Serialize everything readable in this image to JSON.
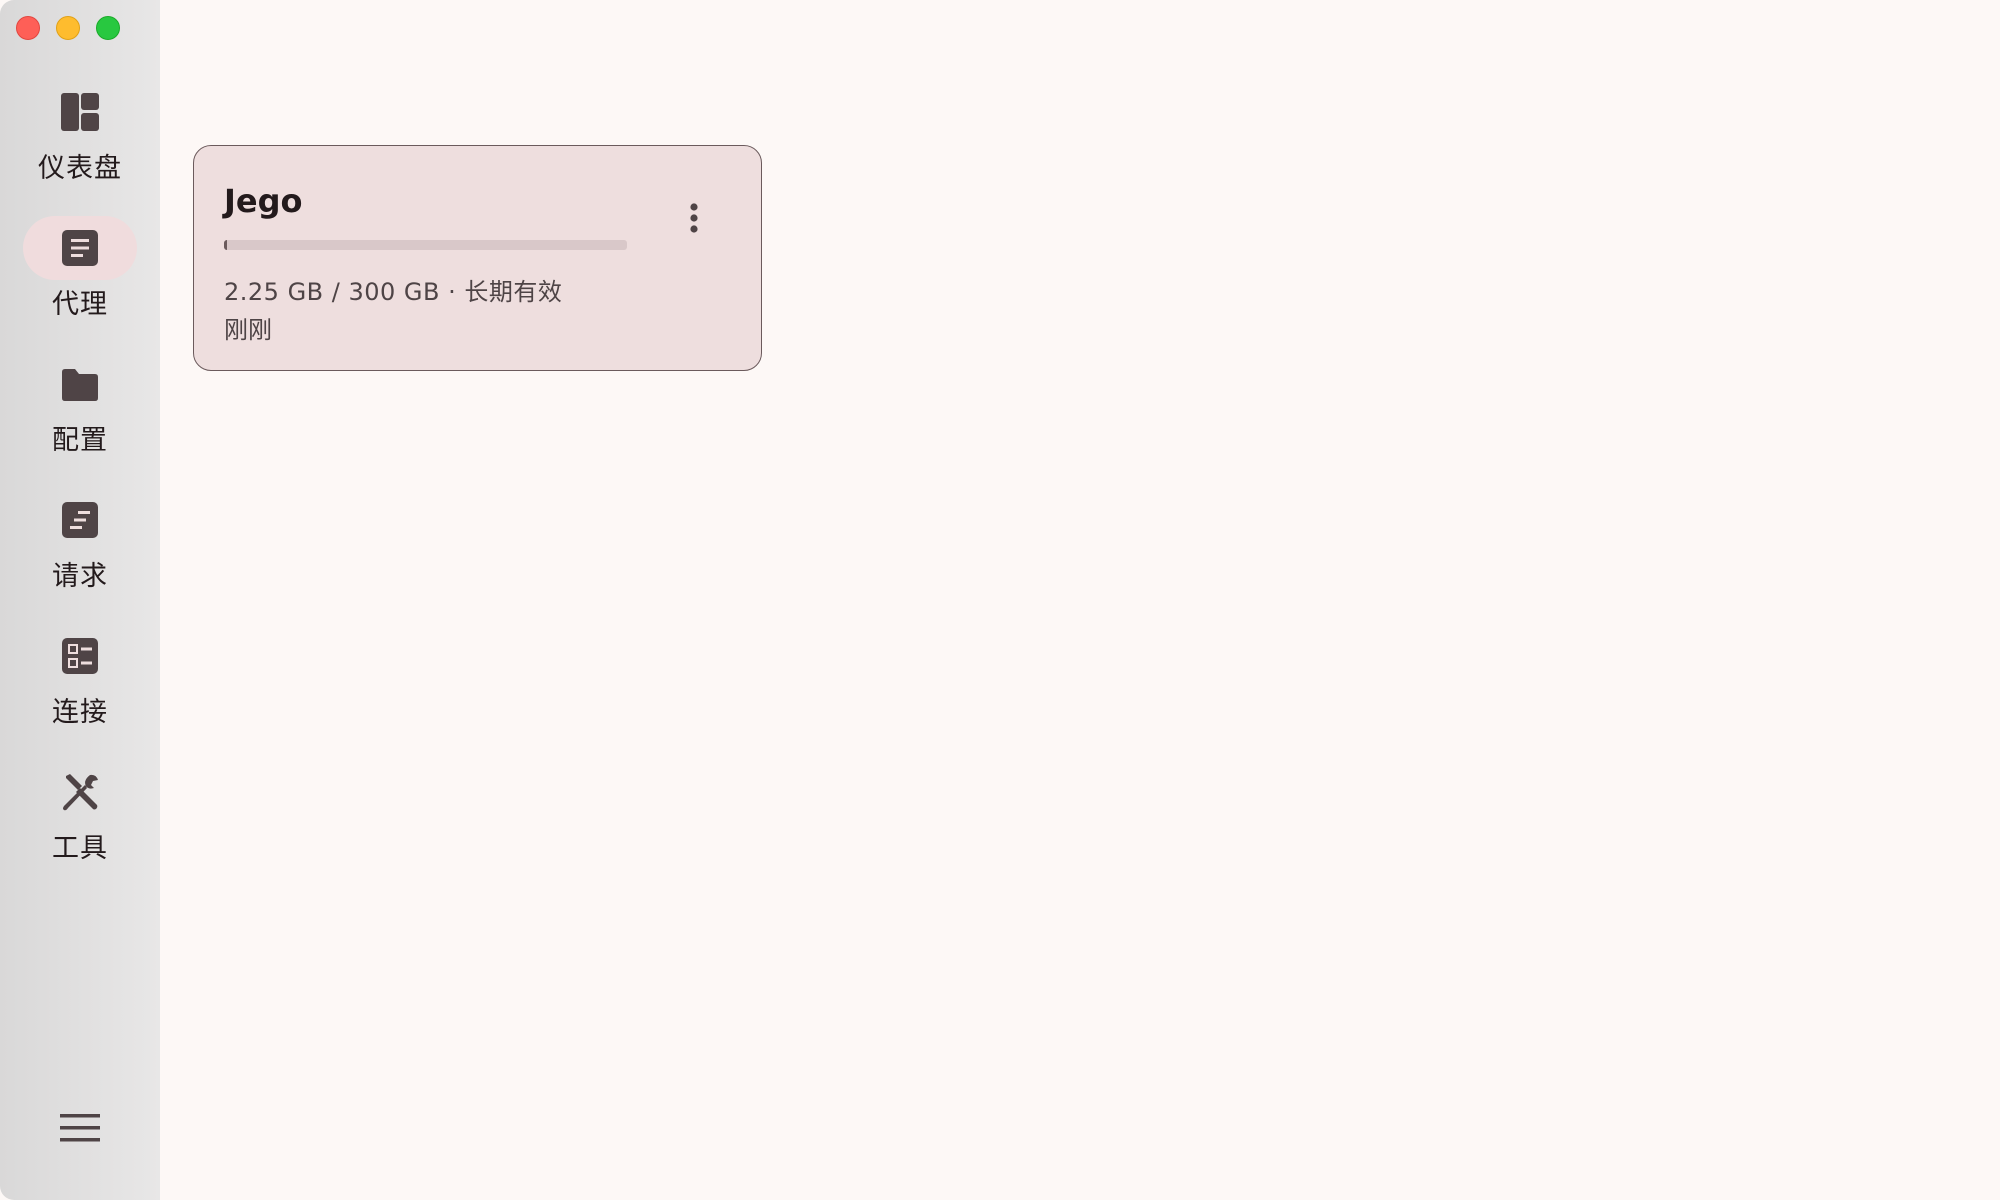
{
  "sidebar": {
    "items": [
      {
        "label": "仪表盘",
        "icon": "dashboard-icon",
        "active": false
      },
      {
        "label": "代理",
        "icon": "proxy-list-icon",
        "active": true
      },
      {
        "label": "配置",
        "icon": "folder-icon",
        "active": false
      },
      {
        "label": "请求",
        "icon": "requests-icon",
        "active": false
      },
      {
        "label": "连接",
        "icon": "connections-icon",
        "active": false
      },
      {
        "label": "工具",
        "icon": "tools-icon",
        "active": false
      }
    ],
    "menu_icon": "hamburger-menu-icon"
  },
  "profile_card": {
    "name": "Jego",
    "usage_text": "2.25 GB / 300 GB · 长期有效",
    "updated": "刚刚",
    "usage_fraction": 0.0075,
    "more_icon": "more-vert-icon"
  },
  "colors": {
    "background": "#fdf8f6",
    "sidebar": "#e0dfdf",
    "card_background": "#eedede",
    "active_pill": "#f0dcdd",
    "icon": "#4f4446",
    "text": "#231a1c"
  }
}
